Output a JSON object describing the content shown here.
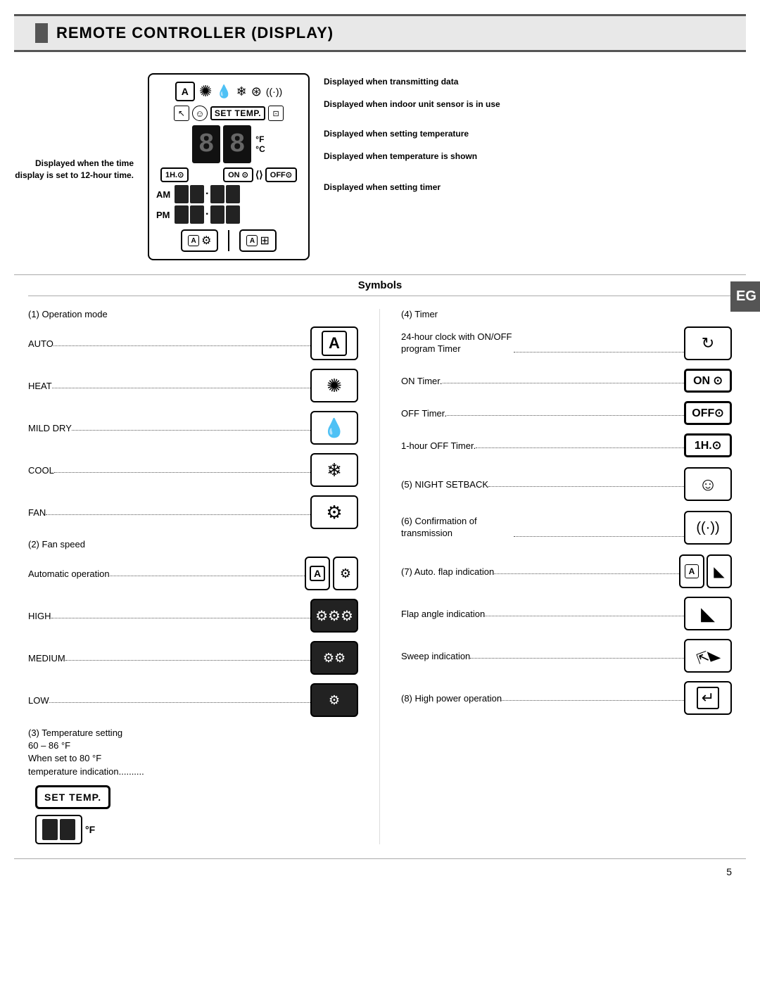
{
  "header": {
    "title": "REMOTE CONTROLLER (DISPLAY)"
  },
  "eg_label": "EG",
  "display": {
    "set_temp_label": "SET TEMP.",
    "degree_f": "°F",
    "degree_c": "°C",
    "am_label": "AM",
    "pm_label": "PM"
  },
  "annotations_right": [
    {
      "text": "Displayed when transmitting data"
    },
    {
      "text": "Displayed when indoor unit sensor is in use"
    },
    {
      "text": "Displayed when setting temperature"
    },
    {
      "text": "Displayed when temperature is shown"
    },
    {
      "text": "Displayed when setting timer"
    }
  ],
  "annotations_left": {
    "text": "Displayed when the time display is set to 12-hour time."
  },
  "symbols": {
    "header": "Symbols",
    "left_col": {
      "section1_title": "(1) Operation mode",
      "items": [
        {
          "label": "AUTO",
          "icon": "Ⓐ"
        },
        {
          "label": "HEAT",
          "icon": "☀"
        },
        {
          "label": "MILD DRY",
          "icon": "🌢"
        },
        {
          "label": "COOL",
          "icon": "❄"
        },
        {
          "label": "FAN",
          "icon": "⚙"
        }
      ],
      "section2_title": "(2) Fan speed",
      "fan_items": [
        {
          "label": "Automatic operation",
          "icon": "dual"
        },
        {
          "label": "HIGH",
          "icon": "high"
        },
        {
          "label": "MEDIUM",
          "icon": "med"
        },
        {
          "label": "LOW",
          "icon": "low"
        }
      ],
      "section3_title": "(3) Temperature setting\n60 – 86 °F\nWhen set to 80 °F\ntemperature indication...........",
      "section3_icon": "SET TEMP."
    },
    "right_col": {
      "section4_title": "(4) Timer",
      "items": [
        {
          "label": "24-hour clock with ON/OFF\nprogram Timer",
          "icon": "clock"
        },
        {
          "label": "ON Timer.",
          "icon": "on"
        },
        {
          "label": "OFF Timer.",
          "icon": "off"
        },
        {
          "label": "1-hour OFF Timer.",
          "icon": "1h"
        }
      ],
      "section5_title": "(5) NIGHT SETBACK",
      "section5_icon": "face",
      "section6_title": "(6) Confirmation\nof transmission",
      "section6_icon": "wifi",
      "section7_title": "(7) Auto. flap indication",
      "section7_icon": "a-flap",
      "flap_angle": {
        "label": "Flap angle indication",
        "icon": "flap"
      },
      "sweep": {
        "label": "Sweep indication",
        "icon": "sweep"
      },
      "section8_title": "(8) High power operation",
      "section8_icon": "power"
    }
  },
  "page_number": "5"
}
